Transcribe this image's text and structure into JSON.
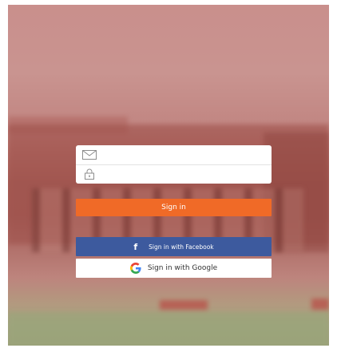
{
  "login_form": {
    "email": {
      "icon": "envelope-icon",
      "value": "",
      "placeholder": ""
    },
    "password": {
      "icon": "lock-icon",
      "value": "",
      "placeholder": ""
    }
  },
  "buttons": {
    "sign_in_label": "Sign in",
    "facebook_label": "Sign in with Facebook",
    "facebook_icon": "facebook-f-icon",
    "google_label": "Sign in with Google",
    "google_icon": "google-g-icon"
  },
  "colors": {
    "sign_in": "#f06a27",
    "facebook": "#3d5a9e",
    "google_bg": "#ffffff"
  }
}
